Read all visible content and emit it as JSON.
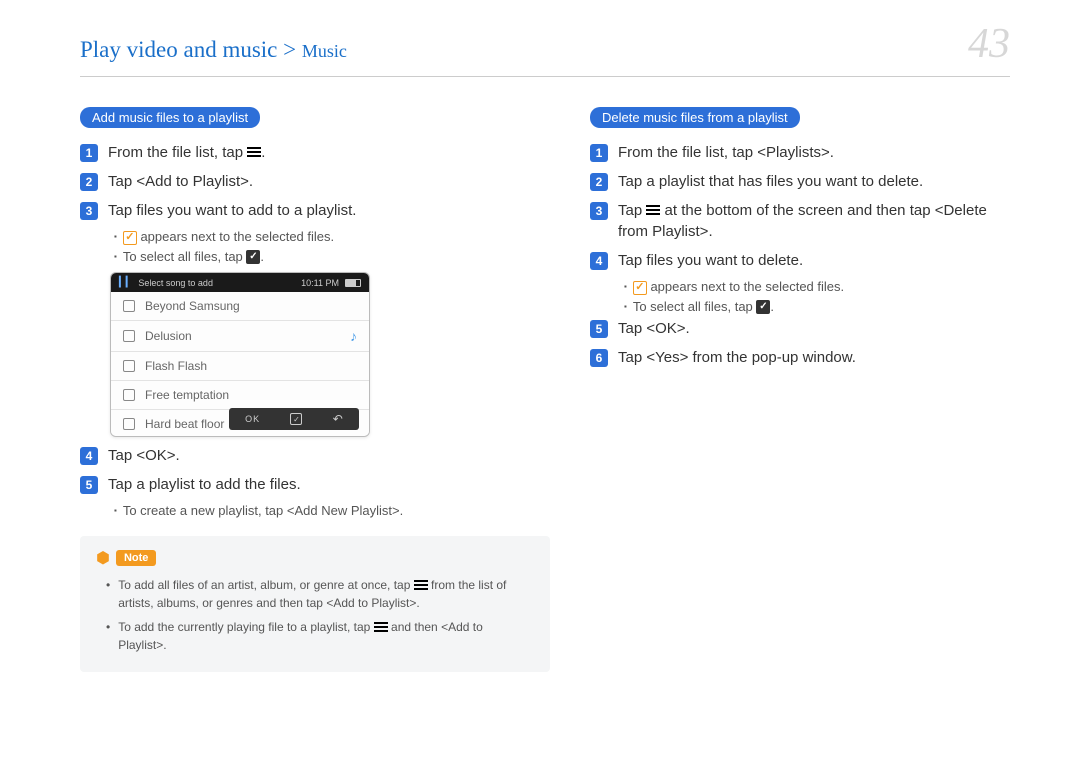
{
  "header": {
    "breadcrumb_main": "Play video and music",
    "breadcrumb_sep": " > ",
    "breadcrumb_sub": "Music",
    "page_number": "43"
  },
  "left": {
    "section_title": "Add music files to a playlist",
    "steps": {
      "s1_pre": "From the file list, tap ",
      "s1_post": ".",
      "s2": "Tap <Add to Playlist>.",
      "s3": "Tap files you want to add to a playlist.",
      "s3_b1_pre": "",
      "s3_b1_post": " appears next to the selected files.",
      "s3_b2_pre": "To select all files, tap ",
      "s3_b2_post": ".",
      "s4": "Tap <OK>.",
      "s5": "Tap a playlist to add the files.",
      "s5_b1": "To create a new playlist, tap <Add New Playlist>."
    },
    "device": {
      "title": "Select song to add",
      "time": "10:11 PM",
      "rows": [
        "Beyond Samsung",
        "Delusion",
        "Flash Flash",
        "Free temptation",
        "Hard beat floor"
      ],
      "ok": "OK"
    },
    "note": {
      "label": "Note",
      "b1_pre": "To add all files of an artist, album, or genre at once, tap ",
      "b1_post": " from the list of artists, albums, or genres and then tap <Add to Playlist>.",
      "b2_pre": "To add the currently playing file to a playlist, tap ",
      "b2_post": " and then <Add to Playlist>."
    }
  },
  "right": {
    "section_title": "Delete music files from a playlist",
    "steps": {
      "s1": "From the file list, tap <Playlists>.",
      "s2": "Tap a playlist that has files you want to delete.",
      "s3_pre": "Tap ",
      "s3_post": " at the bottom of the screen and then tap <Delete from Playlist>.",
      "s4": "Tap files you want to delete.",
      "s4_b1_pre": "",
      "s4_b1_post": " appears next to the selected files.",
      "s4_b2_pre": "To select all files, tap ",
      "s4_b2_post": ".",
      "s5": "Tap <OK>.",
      "s6": "Tap <Yes> from the pop-up window."
    }
  }
}
